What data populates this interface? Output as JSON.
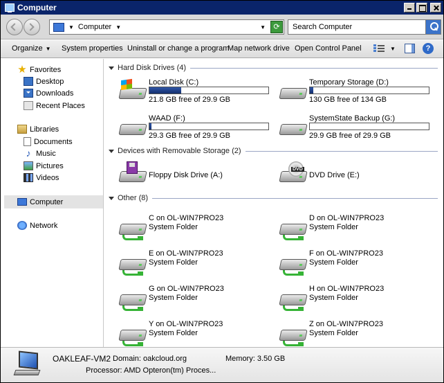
{
  "window": {
    "title": "Computer"
  },
  "address": {
    "path": "Computer"
  },
  "search": {
    "placeholder": "Search Computer"
  },
  "toolbar": {
    "organize": "Organize",
    "system_properties": "System properties",
    "uninstall": "Uninstall or change a program",
    "map_drive": "Map network drive",
    "open_cp": "Open Control Panel"
  },
  "sidebar": {
    "favorites": "Favorites",
    "desktop": "Desktop",
    "downloads": "Downloads",
    "recent": "Recent Places",
    "libraries": "Libraries",
    "documents": "Documents",
    "music": "Music",
    "pictures": "Pictures",
    "videos": "Videos",
    "computer": "Computer",
    "network": "Network"
  },
  "groups": {
    "hdd": "Hard Disk Drives (4)",
    "removable": "Devices with Removable Storage (2)",
    "other": "Other (8)"
  },
  "drives": [
    {
      "name": "Local Disk (C:)",
      "free": "21.8 GB free of 29.9 GB",
      "used_fraction": 0.27
    },
    {
      "name": "Temporary Storage (D:)",
      "free": "130 GB free of 134 GB",
      "used_fraction": 0.03
    },
    {
      "name": "WAAD (F:)",
      "free": "29.3 GB free of 29.9 GB",
      "used_fraction": 0.02
    },
    {
      "name": "SystemState Backup (G:)",
      "free": "29.9 GB free of 29.9 GB",
      "used_fraction": 0.0
    }
  ],
  "removable": [
    {
      "name": "Floppy Disk Drive (A:)"
    },
    {
      "name": "DVD Drive (E:)"
    }
  ],
  "dvd_label": "DVD",
  "other": [
    {
      "name": "C on OL-WIN7PRO23",
      "type": "System Folder"
    },
    {
      "name": "D on OL-WIN7PRO23",
      "type": "System Folder"
    },
    {
      "name": "E on OL-WIN7PRO23",
      "type": "System Folder"
    },
    {
      "name": "F on OL-WIN7PRO23",
      "type": "System Folder"
    },
    {
      "name": "G on OL-WIN7PRO23",
      "type": "System Folder"
    },
    {
      "name": "H on OL-WIN7PRO23",
      "type": "System Folder"
    },
    {
      "name": "Y on OL-WIN7PRO23",
      "type": "System Folder"
    },
    {
      "name": "Z on OL-WIN7PRO23",
      "type": "System Folder"
    }
  ],
  "details": {
    "computer_name": "OAKLEAF-VM2",
    "domain": "Domain: oakcloud.org",
    "memory": "Memory: 3.50 GB",
    "processor": "Processor: AMD Opteron(tm) Proces..."
  }
}
